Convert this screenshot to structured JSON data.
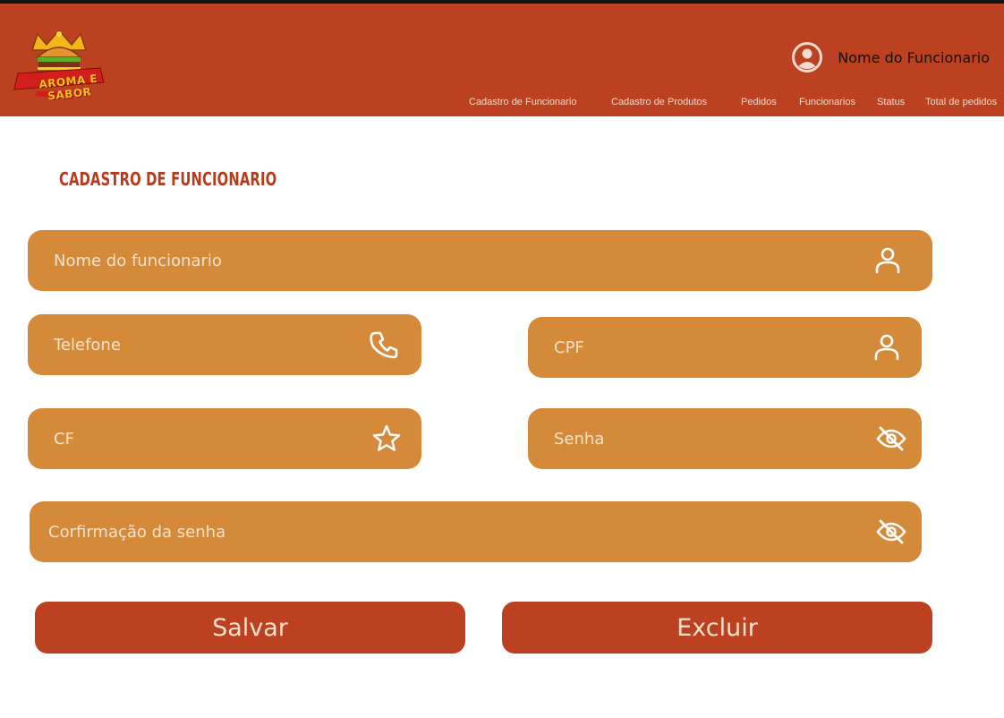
{
  "header": {
    "logo_text": "AROMA E SABOR",
    "user_name": "Nome do Funcionario",
    "nav": [
      "Cadastro de Funcionario",
      "Cadastro de Produtos",
      "Pedidos",
      "Funcionarios",
      "Status",
      "Total de pedidos"
    ]
  },
  "page": {
    "title": "CADASTRO DE FUNCIONARIO"
  },
  "form": {
    "nome": {
      "placeholder": "Nome do funcionario",
      "icon": "user-icon"
    },
    "telefone": {
      "placeholder": "Telefone",
      "icon": "phone-icon"
    },
    "cpf": {
      "placeholder": "CPF",
      "icon": "user-icon"
    },
    "cf": {
      "placeholder": "CF",
      "icon": "star-icon"
    },
    "senha": {
      "placeholder": "Senha",
      "icon": "eye-off-icon"
    },
    "confirmacao": {
      "placeholder": "Corfirmação da senha",
      "icon": "eye-off-icon"
    }
  },
  "buttons": {
    "save": "Salvar",
    "delete": "Excluir"
  },
  "colors": {
    "header_bg": "#bb4121",
    "field_bg": "#d58a3a",
    "button_bg": "#bb4121",
    "title": "#b63a1c",
    "field_text": "#f7e3cd"
  }
}
